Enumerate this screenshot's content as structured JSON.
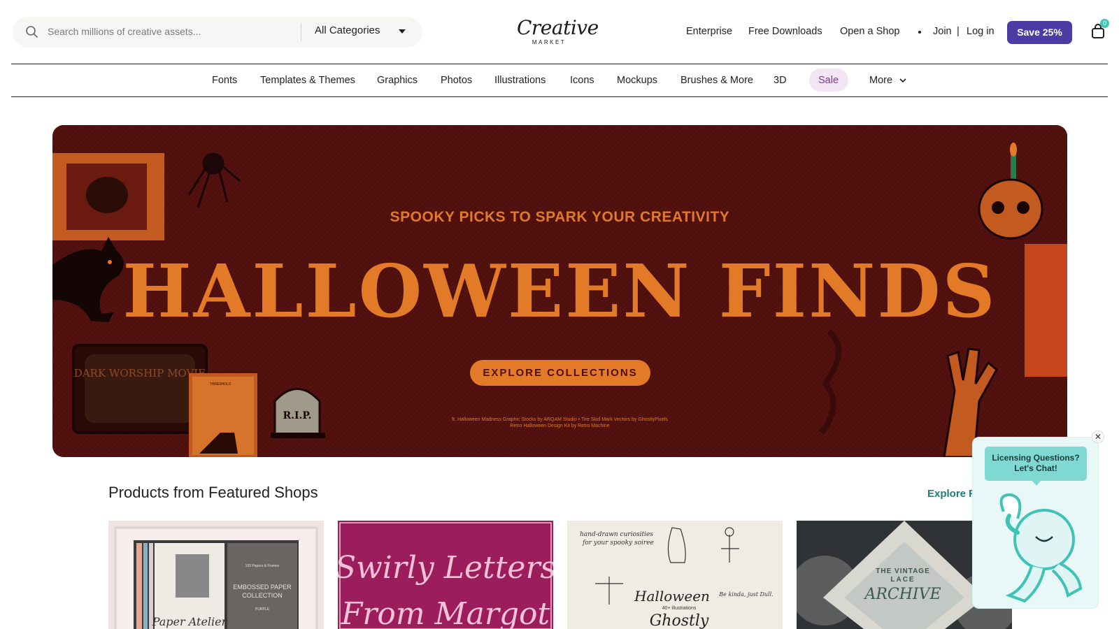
{
  "header": {
    "search_placeholder": "Search millions of creative assets...",
    "category_select": "All Categories",
    "logo_main": "Creative",
    "logo_sub": "MARKET",
    "links": [
      "Enterprise",
      "Free Downloads",
      "Open a Shop"
    ],
    "join": "Join",
    "separator": "|",
    "login": "Log in",
    "save_button": "Save 25%",
    "cart_count": "0"
  },
  "nav": {
    "items": [
      "Fonts",
      "Templates & Themes",
      "Graphics",
      "Photos",
      "Illustrations",
      "Icons",
      "Mockups",
      "Brushes & More",
      "3D",
      "Sale",
      "More"
    ]
  },
  "hero": {
    "tagline": "SPOOKY PICKS TO SPARK YOUR CREATIVITY",
    "title": "HALLOWEEN FINDS",
    "cta": "EXPLORE COLLECTIONS",
    "credit_line1": "ft. Halloween Madness Graphic Stocks by ARQAM Studio • Tire Skid Mark Vectors by GhostlyPixels",
    "credit_line2": "Retro Halloween Design Kit by Retro Machine",
    "artwork": {
      "tv_text": "DARK WORSHIP MOVIE",
      "tombstone_text": "R.I.P.",
      "book_text": "THRESHOLD"
    },
    "colors": {
      "background": "#4e0f0d",
      "accent": "#e27a27"
    }
  },
  "featured": {
    "title": "Products from Featured Shops",
    "explore_link": "Explore F",
    "products": [
      {
        "art_line1": "EMBOSSED PAPER",
        "art_line2": "COLLECTION",
        "art_small": "100 Papers & Frames",
        "brand": "PURPLE",
        "art_script": "Paper Atelier"
      },
      {
        "art_line1": "Swirly Letters",
        "art_line2": "From Margot"
      },
      {
        "art_line1": "hand-drawn curiosities",
        "art_line2": "for your spooky soiree",
        "art_title": "Halloween",
        "art_sub": "40+ illustrations",
        "art_script": "Ghostly",
        "art_tag": "Be kinda, just Dull."
      },
      {
        "art_line1": "THE VINTAGE",
        "art_line2": "LACE",
        "art_line3": "ARCHIVE"
      }
    ]
  },
  "chat": {
    "bubble_line1": "Licensing Questions?",
    "bubble_line2": "Let's Chat!",
    "close_icon": "x-icon"
  }
}
